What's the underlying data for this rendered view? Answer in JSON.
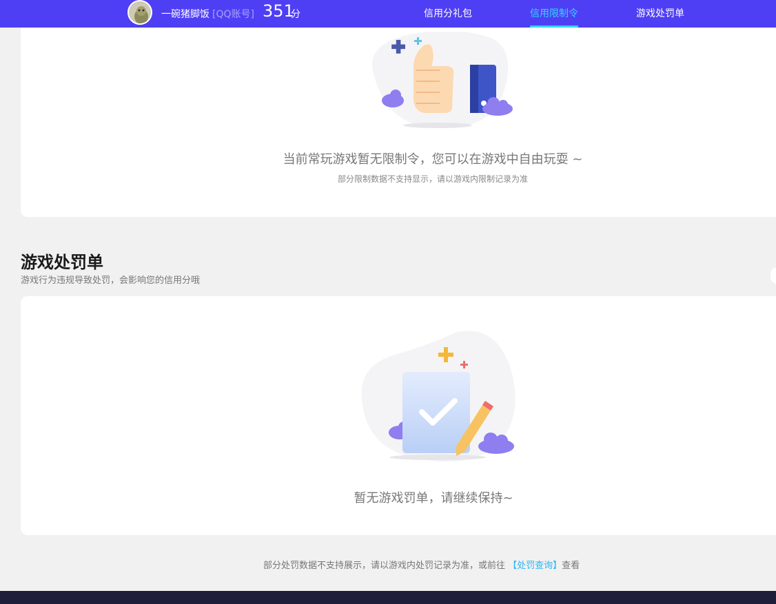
{
  "header": {
    "username": "一碗猪脚饭",
    "account_type": "[QQ账号]",
    "score": "351",
    "score_unit": "分",
    "tabs": [
      {
        "label": "信用分礼包",
        "active": false
      },
      {
        "label": "信用限制令",
        "active": true
      },
      {
        "label": "游戏处罚单",
        "active": false
      }
    ]
  },
  "restriction": {
    "message": "当前常玩游戏暂无限制令，您可以在游戏中自由玩耍 ~",
    "note": "部分限制数据不支持显示，请以游戏内限制记录为准"
  },
  "penalty": {
    "title": "游戏处罚单",
    "description": "游戏行为违规导致处罚，会影响您的信用分哦",
    "message": "暂无游戏罚单，请继续保持~",
    "footnote_prefix": "部分处罚数据不支持展示，请以游戏内处罚记录为准，或前往 ",
    "footnote_link": "【处罚查询】",
    "footnote_suffix": "查看"
  },
  "colors": {
    "header_bg": "#4e3ff5",
    "active_tab": "#37d3ff",
    "link": "#2fb4f2"
  }
}
